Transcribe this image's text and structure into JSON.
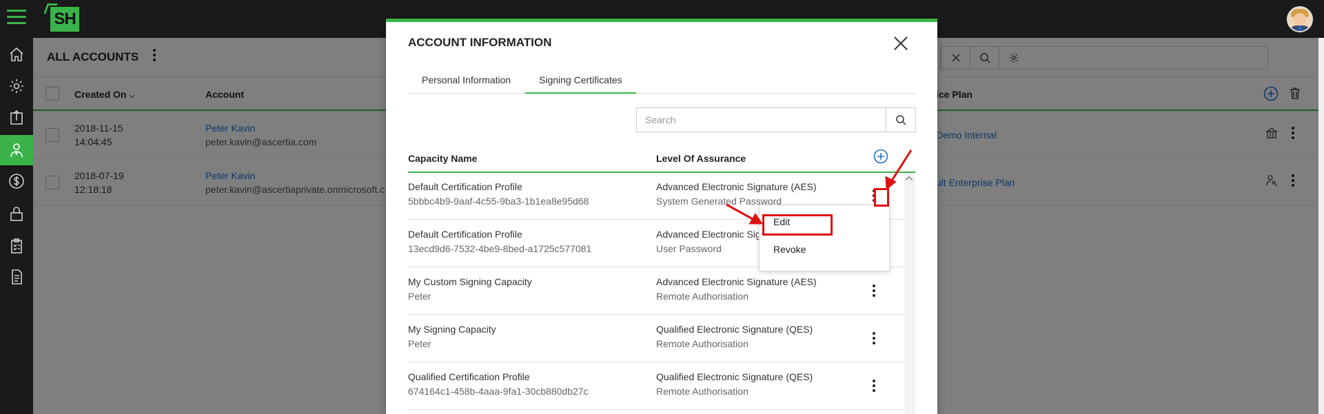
{
  "topbar": {
    "logo": "SH"
  },
  "sidebar": {
    "items": [
      "home-icon",
      "gear-icon",
      "upload-icon",
      "user-icon",
      "dollar-icon",
      "lock-icon",
      "clipboard-check-icon",
      "document-icon"
    ],
    "active": "user-icon"
  },
  "page": {
    "title": "ALL ACCOUNTS",
    "columns": {
      "created_on": "Created On",
      "account": "Account",
      "service_plan": "ice Plan"
    },
    "rows": [
      {
        "date": "2018-11-15",
        "time": "14:04:45",
        "name": "Peter Kavin",
        "email": "peter.kavin@ascertia.com",
        "plan": "Demo Internal"
      },
      {
        "date": "2018-07-19",
        "time": "12:18:18",
        "name": "Peter Kavin",
        "email": "peter.kavin@ascertiaprivate.onmicrosoft.c",
        "plan": "ult Enterprise Plan"
      }
    ]
  },
  "modal": {
    "title": "ACCOUNT INFORMATION",
    "tabs": [
      "Personal Information",
      "Signing Certificates"
    ],
    "active_tab": "Signing Certificates",
    "search": {
      "placeholder": "Search",
      "value": ""
    },
    "columns": {
      "capacity": "Capacity Name",
      "assurance": "Level Of Assurance"
    },
    "rows": [
      {
        "name": "Default Certification Profile",
        "sub": "5bbbc4b9-9aaf-4c55-9ba3-1b1ea8e95d68",
        "level": "Advanced Electronic Signature (AES)",
        "auth": "System Generated Password"
      },
      {
        "name": "Default Certification Profile",
        "sub": "13ecd9d6-7532-4be9-8bed-a1725c577081",
        "level": "Advanced Electronic Sig",
        "auth": "User Password"
      },
      {
        "name": "My Custom Signing Capacity",
        "sub": "Peter",
        "level": "Advanced Electronic Signature (AES)",
        "auth": "Remote Authorisation"
      },
      {
        "name": "My Signing Capacity",
        "sub": "Peter",
        "level": "Qualified Electronic Signature (QES)",
        "auth": "Remote Authorisation"
      },
      {
        "name": "Qualified Certification Profile",
        "sub": "674164c1-458b-4aaa-9fa1-30cb880db27c",
        "level": "Qualified Electronic Signature (QES)",
        "auth": "Remote Authorisation"
      }
    ],
    "menu": {
      "edit": "Edit",
      "revoke": "Revoke"
    }
  },
  "colors": {
    "accent": "#3bb34a",
    "link": "#1f6fcf",
    "annotation": "#e01010"
  }
}
